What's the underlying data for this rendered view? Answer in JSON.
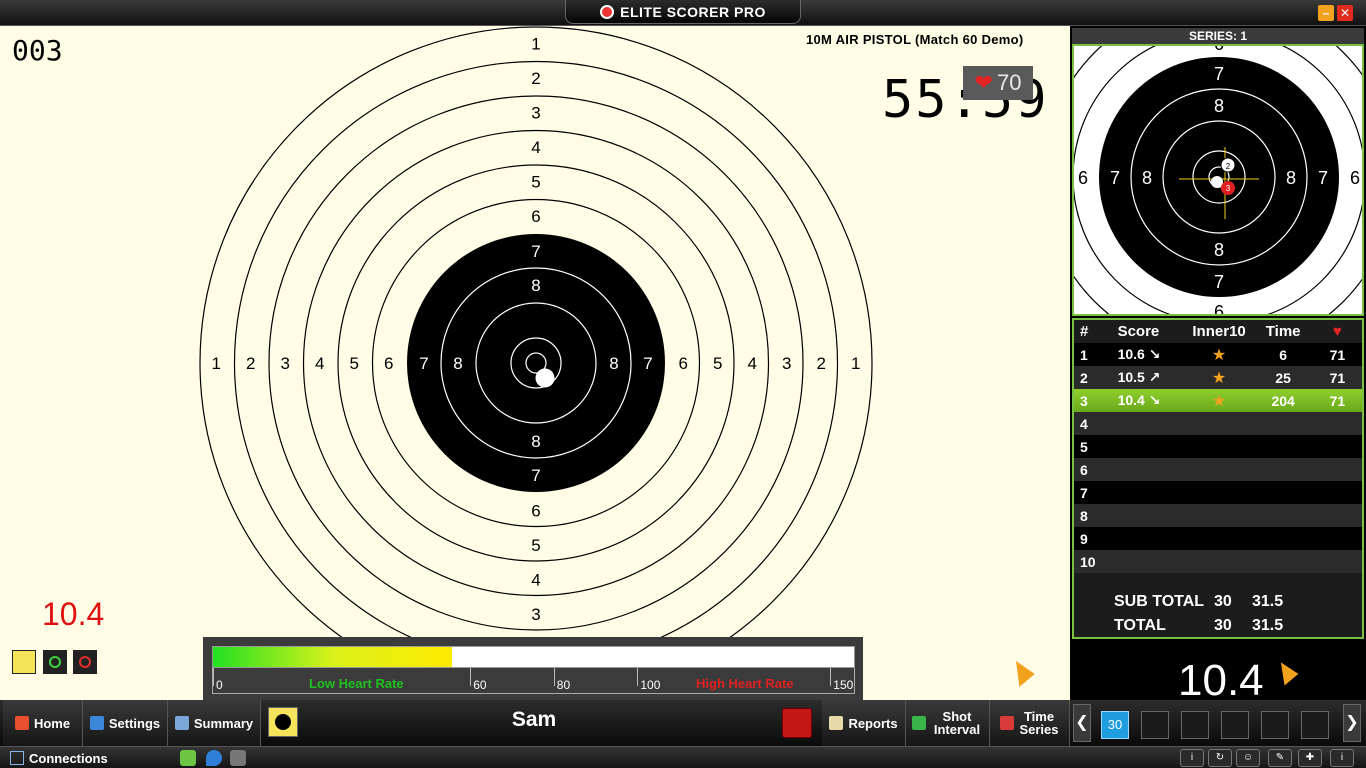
{
  "window": {
    "title": "ELITE SCORER PRO",
    "minimize": "–",
    "close": "✕"
  },
  "target": {
    "shot_number": "003",
    "match_title": "10M AIR PISTOL (Match 60 Demo)",
    "timer": "55:59",
    "heart_rate": "70",
    "last_score": "10.4",
    "ring_numbers": [
      "1",
      "2",
      "3",
      "4",
      "5",
      "6",
      "7",
      "8"
    ]
  },
  "heart_rate_bar": {
    "value": 70,
    "max": 150,
    "low_label": "Low Heart Rate",
    "high_label": "High Heart Rate",
    "ticks": [
      "0",
      "60",
      "80",
      "100",
      "150"
    ]
  },
  "series_panel": {
    "series_label": "SERIES: 1",
    "columns": [
      "#",
      "Score",
      "Inner10",
      "Time",
      "♥"
    ],
    "rows": [
      {
        "num": "1",
        "score": "10.6 ↘",
        "inner": "★",
        "time": "6",
        "hr": "71"
      },
      {
        "num": "2",
        "score": "10.5 ↗",
        "inner": "★",
        "time": "25",
        "hr": "71"
      },
      {
        "num": "3",
        "score": "10.4 ↘",
        "inner": "★",
        "time": "204",
        "hr": "71"
      },
      {
        "num": "4",
        "score": "",
        "inner": "",
        "time": "",
        "hr": ""
      },
      {
        "num": "5",
        "score": "",
        "inner": "",
        "time": "",
        "hr": ""
      },
      {
        "num": "6",
        "score": "",
        "inner": "",
        "time": "",
        "hr": ""
      },
      {
        "num": "7",
        "score": "",
        "inner": "",
        "time": "",
        "hr": ""
      },
      {
        "num": "8",
        "score": "",
        "inner": "",
        "time": "",
        "hr": ""
      },
      {
        "num": "9",
        "score": "",
        "inner": "",
        "time": "",
        "hr": ""
      },
      {
        "num": "10",
        "score": "",
        "inner": "",
        "time": "",
        "hr": ""
      }
    ],
    "subtotal_label": "SUB TOTAL",
    "subtotal_int": "30",
    "subtotal_dec": "31.5",
    "total_label": "TOTAL",
    "total_int": "30",
    "total_dec": "31.5",
    "big_score": "10.4"
  },
  "toolbar": {
    "home": "Home",
    "settings": "Settings",
    "summary": "Summary",
    "shooter": "Sam",
    "reports": "Reports",
    "shot_interval": "Shot Interval",
    "time_series": "Time Series",
    "series_tiles": [
      "30",
      "",
      "",
      "",
      "",
      ""
    ]
  },
  "statusbar": {
    "connections": "Connections"
  },
  "colors": {
    "accent_green": "#7ac142",
    "score_red": "#e01010",
    "orange": "#f2a11c"
  }
}
